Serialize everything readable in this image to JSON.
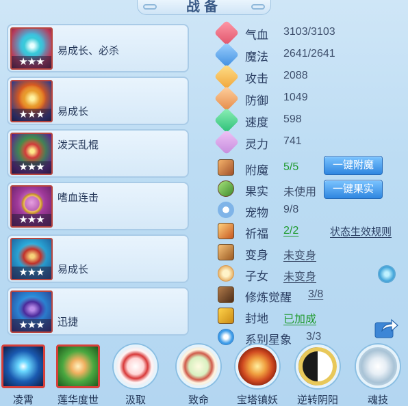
{
  "title": "战备",
  "equipment": [
    {
      "name": "易成长、必杀",
      "stars": "★★★",
      "icon": "gem-armor-icon"
    },
    {
      "name": "易成长",
      "stars": "★★★",
      "icon": "golden-armor-icon"
    },
    {
      "name": "泼天乱棍",
      "stars": "★★★",
      "icon": "crown-icon"
    },
    {
      "name": "嗜血连击",
      "stars": "★★★",
      "icon": "necklace-icon"
    },
    {
      "name": "易成长",
      "stars": "★★★",
      "icon": "belt-icon"
    },
    {
      "name": "迅捷",
      "stars": "★★★",
      "icon": "boots-icon"
    }
  ],
  "attributes": [
    {
      "label": "气血",
      "value": "3103/3103",
      "icon": "heart-icon"
    },
    {
      "label": "魔法",
      "value": "2641/2641",
      "icon": "magic-icon"
    },
    {
      "label": "攻击",
      "value": "2088",
      "icon": "sword-icon"
    },
    {
      "label": "防御",
      "value": "1049",
      "icon": "shield-icon"
    },
    {
      "label": "速度",
      "value": "598",
      "icon": "lightning-icon"
    },
    {
      "label": "灵力",
      "value": "741",
      "icon": "spirit-icon"
    }
  ],
  "extras": [
    {
      "label": "附魔",
      "value": "5/5",
      "icon": "enchant-icon"
    },
    {
      "label": "果实",
      "value": "未使用",
      "icon": "fruit-icon"
    },
    {
      "label": "宠物",
      "value": "9/8",
      "icon": "paw-icon"
    },
    {
      "label": "祈福",
      "value": "2/2",
      "icon": "blessing-icon"
    },
    {
      "label": "变身",
      "value": "未变身",
      "icon": "transform-icon"
    },
    {
      "label": "子女",
      "value": "未变身",
      "icon": "child-icon"
    },
    {
      "label": "修炼觉醒",
      "value": "3/8",
      "icon": "cultivation-icon"
    },
    {
      "label": "封地",
      "value": "已加成",
      "icon": "fief-icon"
    },
    {
      "label": "系别星象",
      "value": "3/3",
      "icon": "star-icon"
    }
  ],
  "buttons": {
    "enchant": "一键附魔",
    "fruit": "一键果实",
    "rules": "状态生效规则"
  },
  "skills": [
    {
      "label": "凌霄",
      "icon": "blue-star-icon"
    },
    {
      "label": "莲华度世",
      "icon": "lotus-hand-icon"
    },
    {
      "label": "汲取",
      "icon": "red-blade-icon"
    },
    {
      "label": "致命",
      "icon": "green-slash-icon"
    },
    {
      "label": "宝塔镇妖",
      "icon": "pagoda-icon"
    },
    {
      "label": "逆转阴阳",
      "icon": "yin-yang-icon"
    },
    {
      "label": "魂技",
      "icon": "skull-icon"
    }
  ],
  "colors": {
    "background": "#bcdcf3",
    "accent": "#2f86e0",
    "positive": "#1f9a2e",
    "frame_red": "#d6403a"
  }
}
